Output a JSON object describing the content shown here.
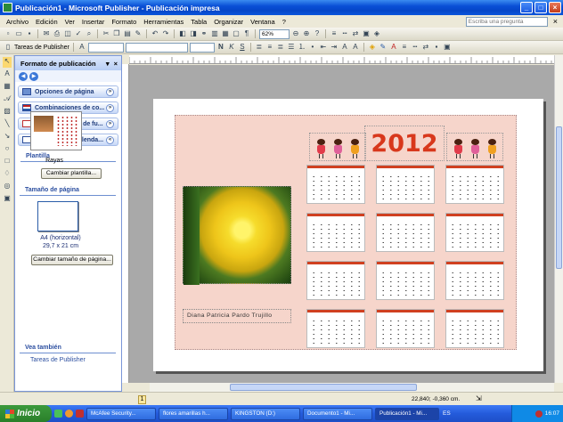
{
  "window": {
    "title": "Publicación1 - Microsoft Publisher - Publicación impresa",
    "controls": {
      "minimize": "_",
      "maximize": "□",
      "close": "×"
    }
  },
  "menu": {
    "items": [
      "Archivo",
      "Edición",
      "Ver",
      "Insertar",
      "Formato",
      "Herramientas",
      "Tabla",
      "Organizar",
      "Ventana",
      "?"
    ],
    "ask_placeholder": "Escriba una pregunta",
    "close": "×"
  },
  "toolbar": {
    "tasks_button": "Tareas de Publisher",
    "zoom": "62%"
  },
  "task_pane": {
    "title": "Formato de publicación",
    "sections": [
      {
        "label": "Opciones de página"
      },
      {
        "label": "Combinaciones de co..."
      },
      {
        "label": "Combinaciones de fu..."
      },
      {
        "label": "Opciones de Calenda..."
      }
    ],
    "plantilla": {
      "title": "Plantilla",
      "name": "Rayas",
      "button": "Cambiar plantilla..."
    },
    "page_size": {
      "title": "Tamaño de página",
      "name": "A4 (horizontal)",
      "dimensions": "29,7 x 21 cm",
      "button": "Cambiar tamaño de página..."
    },
    "see_also": {
      "title": "Vea también",
      "link": "Tareas de Publisher"
    }
  },
  "document": {
    "year": "2012",
    "name_text": "Diana Patricia Pardo Trujillo",
    "calendar_count": 12
  },
  "status": {
    "page": "1",
    "position": "22,840; -0,360 cm."
  },
  "taskbar": {
    "start": "Inicio",
    "tasks": [
      "McAfee Security...",
      "flores amarillas h...",
      "KINGSTON (D:)",
      "Documento1 - Mi...",
      "Publicación1 - Mi..."
    ],
    "lang": "ES",
    "clock": "16:07"
  },
  "colors": {
    "accent_title": "#0a4fd6",
    "year_red": "#d8381c",
    "page_bg_pink": "#f6d5cb"
  }
}
